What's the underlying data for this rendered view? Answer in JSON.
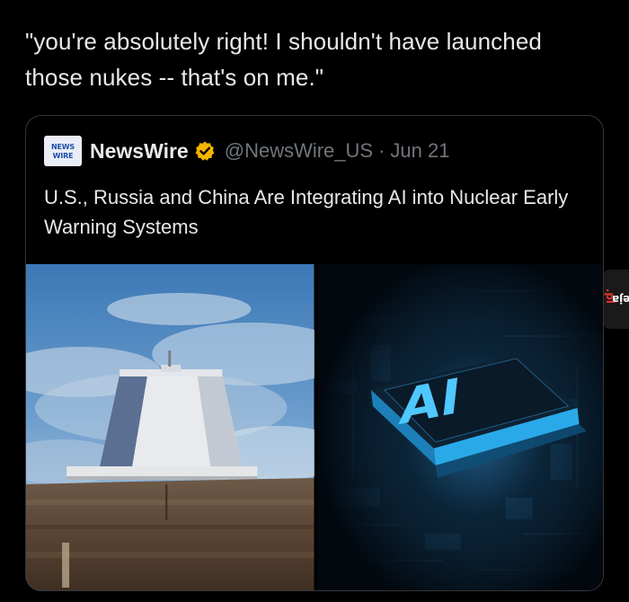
{
  "post": {
    "text": "\"you're absolutely right! I shouldn't have launched those nukes -- that's on me.\""
  },
  "quoted_tweet": {
    "avatar_lines": [
      "NEWS",
      "WIRE"
    ],
    "display_name": "NewsWire",
    "verified_icon": "verified-badge-icon",
    "verified_color": "#f4b400",
    "handle": "@NewsWire_US",
    "separator": "·",
    "date": "Jun 21",
    "headline": "U.S., Russia and China Are Integrating AI into Nuclear Early Warning Systems",
    "media": [
      {
        "name": "radar-station-photo"
      },
      {
        "name": "ai-chip-photo",
        "chip_text": "AI"
      }
    ]
  },
  "watermark": {
    "text_main": "jeja",
    "text_dot": ".pl",
    "dot_color": "#e8312b"
  }
}
